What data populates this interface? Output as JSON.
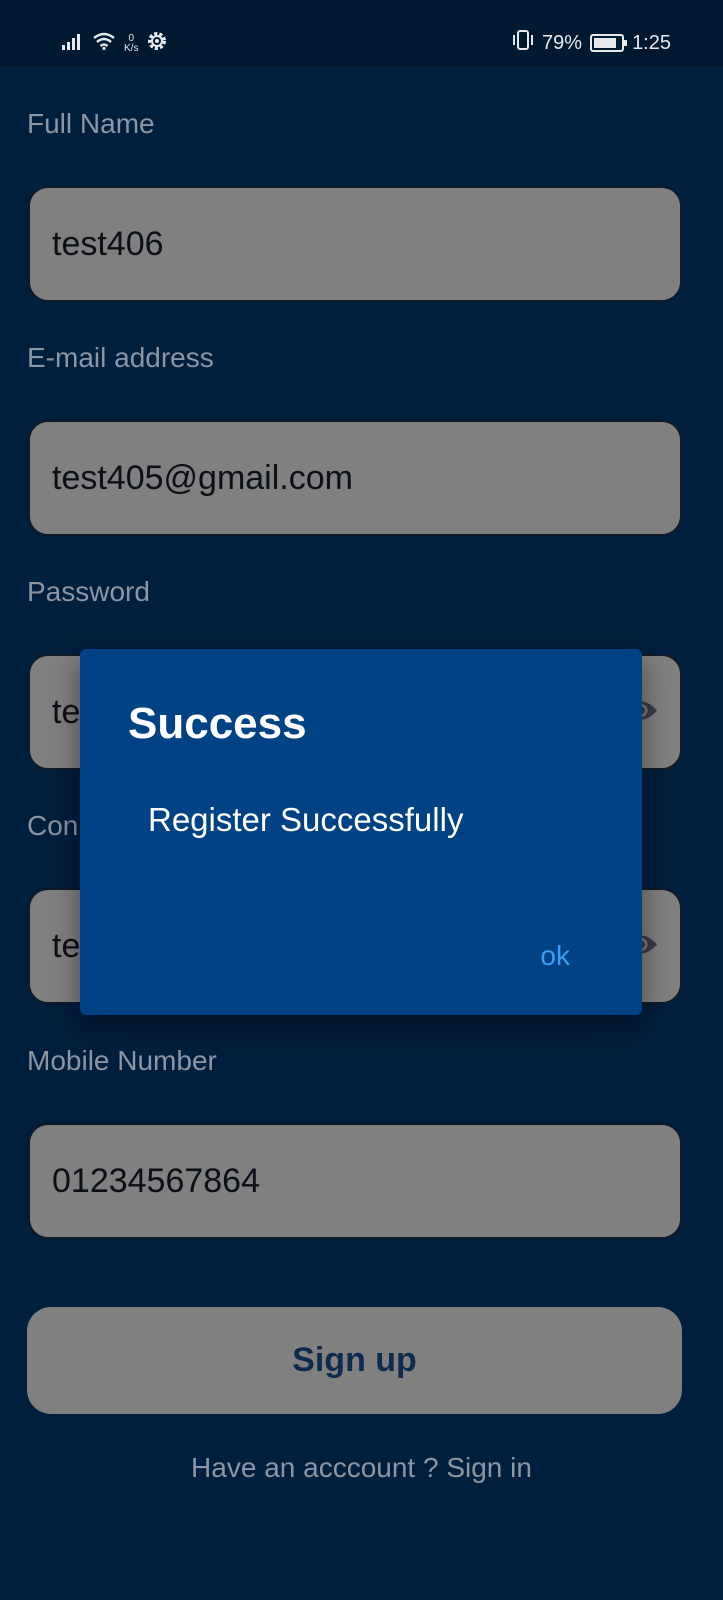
{
  "status_bar": {
    "network_speed_value": "0",
    "network_speed_unit": "K/s",
    "battery_percent": "79%",
    "time": "1:25"
  },
  "form": {
    "full_name": {
      "label": "Full Name",
      "value": "test406"
    },
    "email": {
      "label": "E-mail address",
      "value": "test405@gmail.com"
    },
    "password": {
      "label": "Password",
      "value": "te"
    },
    "confirm_password": {
      "label": "Con",
      "value": "te"
    },
    "mobile": {
      "label": "Mobile Number",
      "value": "01234567864"
    },
    "signup_label": "Sign up",
    "signin_link": "Have an acccount ? Sign in"
  },
  "dialog": {
    "title": "Success",
    "message": "Register Successfully",
    "ok_label": "ok"
  },
  "colors": {
    "background": "#001e3d",
    "field_fill": "#808080",
    "dialog_bg": "#004283",
    "ok_text": "#3d9df5",
    "label_text": "#8b95a3"
  },
  "icons": [
    "signal-icon",
    "wifi-icon",
    "settings-gear-icon",
    "vibrate-icon",
    "battery-icon",
    "eye-icon"
  ]
}
